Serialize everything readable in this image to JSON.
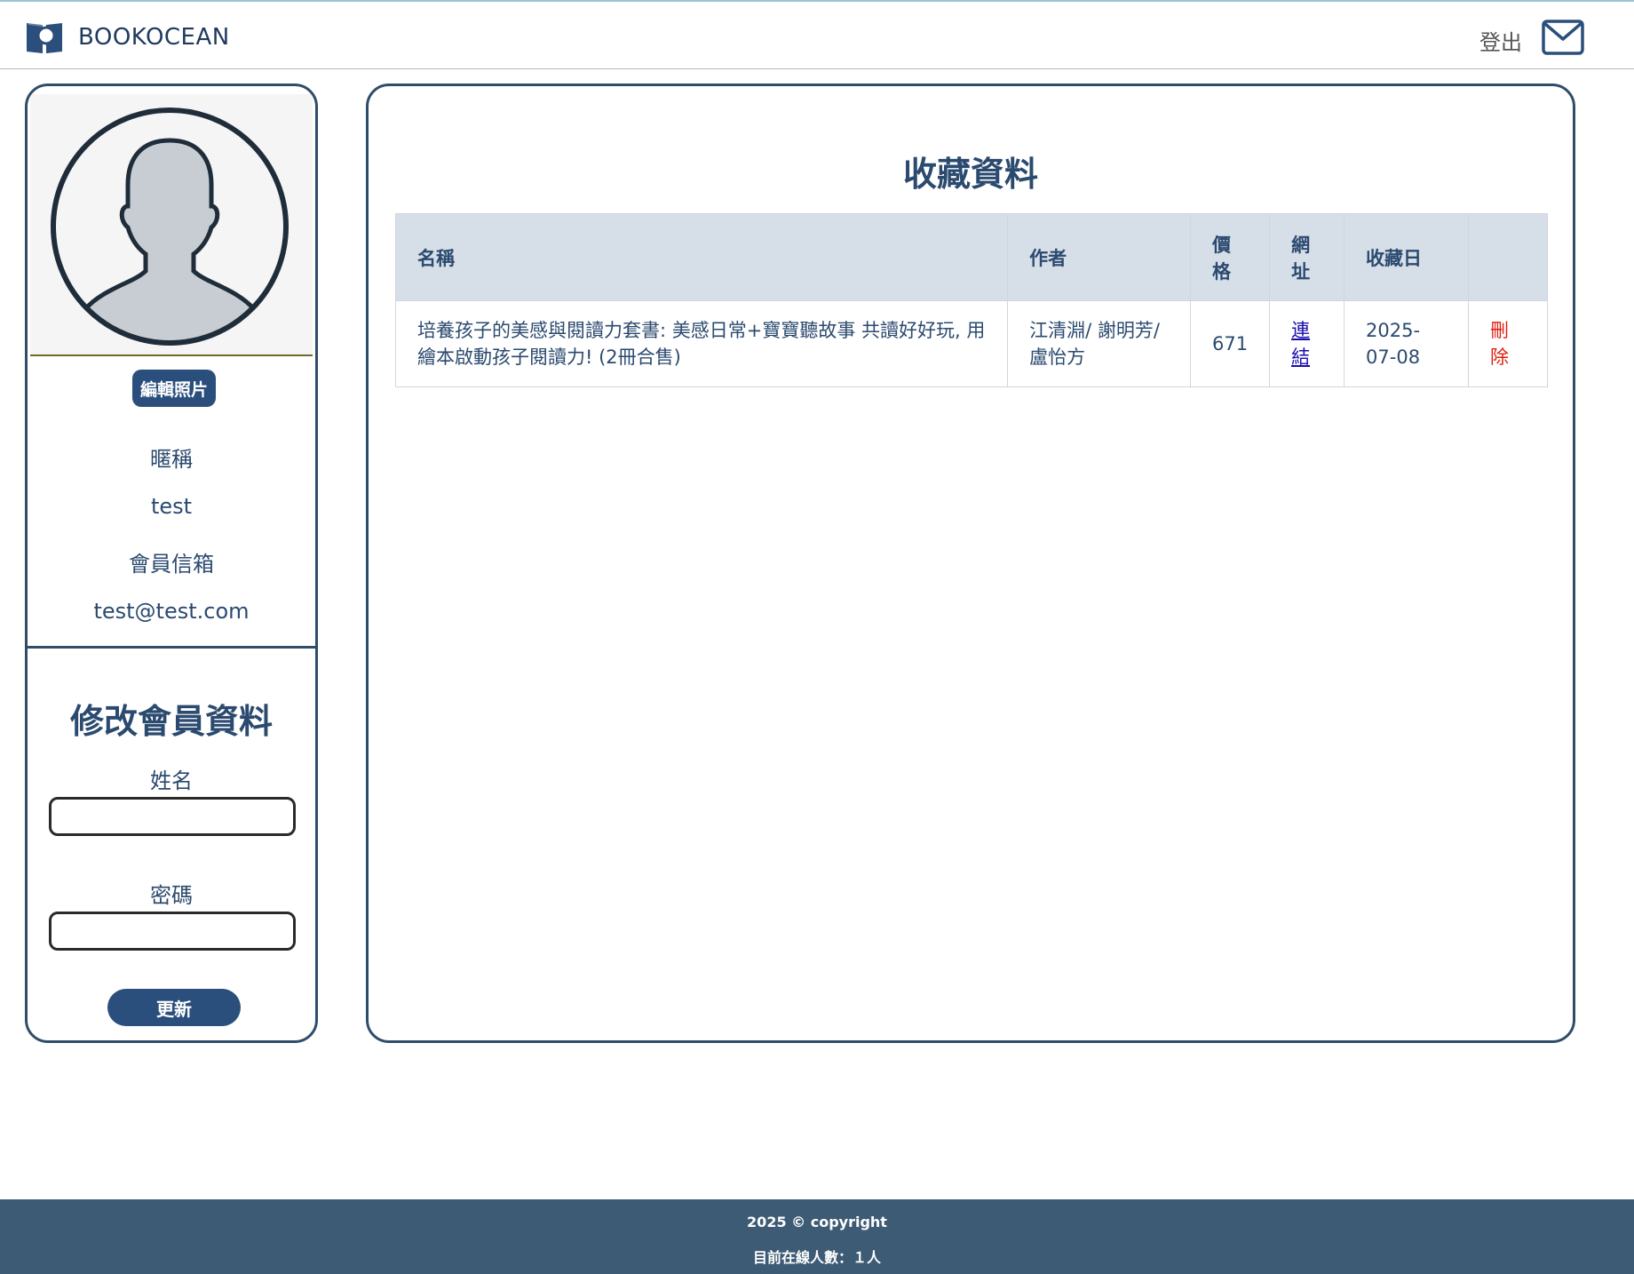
{
  "header": {
    "brand": "BOOKOCEAN",
    "logout": "登出",
    "icons": {
      "logo": "book-search-icon",
      "mail": "mail-icon"
    }
  },
  "sidebar": {
    "edit_photo": "編輯照片",
    "nickname_label": "暱稱",
    "nickname_value": "test",
    "email_label": "會員信箱",
    "email_value": "test@test.com",
    "form_title": "修改會員資料",
    "name_label": "姓名",
    "name_value": "",
    "password_label": "密碼",
    "password_value": "",
    "update_button": "更新"
  },
  "main": {
    "title": "收藏資料",
    "table": {
      "headers": [
        "名稱",
        "作者",
        "價格",
        "網址",
        "收藏日",
        ""
      ],
      "rows": [
        {
          "name": "培養孩子的美感與閱讀力套書: 美感日常+寶寶聽故事 共讀好好玩, 用繪本啟動孩子閱讀力! (2冊合售)",
          "author": "江清淵/ 謝明芳/ 盧怡方",
          "price": "671",
          "link": "連結",
          "date": "2025-07-08",
          "delete": "刪除"
        }
      ]
    }
  },
  "footer": {
    "copyright": "2025 © copyright",
    "online": "目前在線人數：１人"
  },
  "colors": {
    "primary": "#2b4f7c",
    "text": "#2b4a6f",
    "border": "#2f4d6a",
    "table_header_bg": "#d6dee8",
    "footer_bg": "#3d5b74",
    "delete": "#e02010",
    "link": "#1a0dab"
  }
}
